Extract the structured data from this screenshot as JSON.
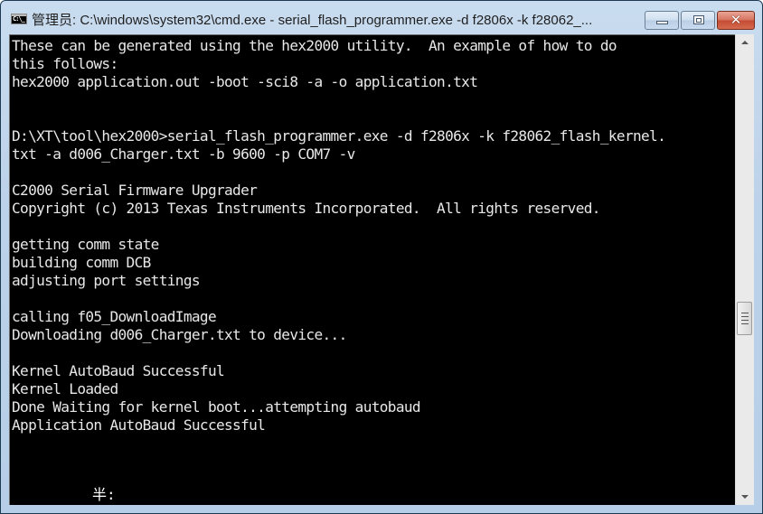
{
  "window": {
    "title": "管理员: C:\\windows\\system32\\cmd.exe - serial_flash_programmer.exe  -d f2806x -k f28062_...",
    "icon": "console-icon",
    "icon_glyph": "C:\\_",
    "controls": {
      "minimize": "minimize-icon",
      "maximize": "maximize-icon",
      "close_glyph": "✕"
    }
  },
  "console": {
    "lines": [
      "These can be generated using the hex2000 utility.  An example of how to do",
      "this follows:",
      "hex2000 application.out -boot -sci8 -a -o application.txt",
      "",
      "",
      "D:\\XT\\tool\\hex2000>serial_flash_programmer.exe -d f2806x -k f28062_flash_kernel.",
      "txt -a d006_Charger.txt -b 9600 -p COM7 -v",
      "",
      "C2000 Serial Firmware Upgrader",
      "Copyright (c) 2013 Texas Instruments Incorporated.  All rights reserved.",
      "",
      "getting comm state",
      "building comm DCB",
      "adjusting port settings",
      "",
      "calling f05_DownloadImage",
      "Downloading d006_Charger.txt to device...",
      "",
      "Kernel AutoBaud Successful",
      "Kernel Loaded",
      "Done Waiting for kernel boot...attempting autobaud",
      "Application AutoBaud Successful"
    ],
    "ime_indicator": "半:"
  },
  "scrollbar": {
    "position_fraction": 0.62
  }
}
